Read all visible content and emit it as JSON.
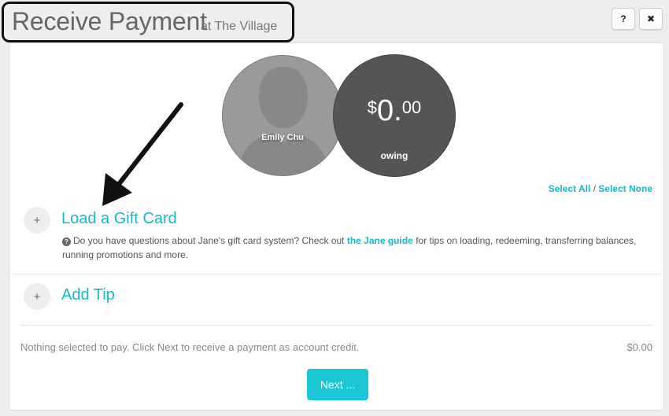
{
  "header": {
    "title": "Receive Payment",
    "subtitle": "at The Village",
    "help_label": "?",
    "close_label": "✖"
  },
  "patient": {
    "name": "Emily Chu"
  },
  "balance": {
    "currency": "$",
    "dollars": "0.",
    "cents": "00",
    "label": "owing"
  },
  "selection": {
    "select_all": "Select All",
    "separator": " / ",
    "select_none": "Select None"
  },
  "gift_card": {
    "expand_label": "+",
    "title": "Load a Gift Card",
    "help_icon": "?",
    "help_prefix": "Do you have questions about Jane's gift card system? Check out ",
    "help_link": "the Jane guide",
    "help_suffix": " for tips on loading, redeeming, transferring balances, running promotions and more."
  },
  "tip": {
    "expand_label": "+",
    "title": "Add Tip"
  },
  "footer": {
    "status": "Nothing selected to pay. Click Next to receive a payment as account credit.",
    "total": "$0.00",
    "next_label": "Next ..."
  },
  "colors": {
    "accent": "#19b8c8",
    "button": "#1cc6d4",
    "owing_circle": "#555555",
    "avatar_circle": "#9a9a9a"
  }
}
